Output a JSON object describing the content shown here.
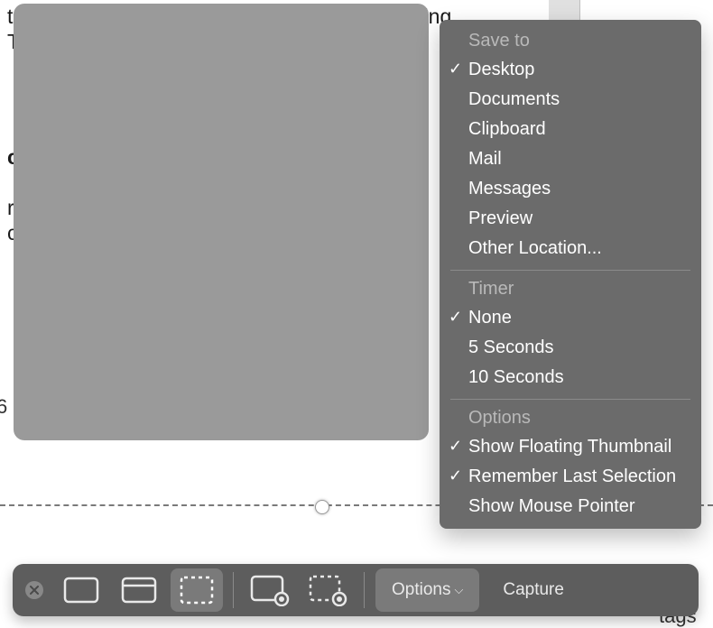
{
  "background": {
    "line1": "t means you want to screenshot without opening",
    "line2": "T",
    "bold": "c",
    "line3": "r",
    "line4": "cl",
    "num": "6",
    "tags": "tags"
  },
  "menu": {
    "save_to": {
      "title": "Save to",
      "items": [
        {
          "label": "Desktop",
          "checked": true
        },
        {
          "label": "Documents",
          "checked": false
        },
        {
          "label": "Clipboard",
          "checked": false
        },
        {
          "label": "Mail",
          "checked": false
        },
        {
          "label": "Messages",
          "checked": false
        },
        {
          "label": "Preview",
          "checked": false
        },
        {
          "label": "Other Location...",
          "checked": false
        }
      ]
    },
    "timer": {
      "title": "Timer",
      "items": [
        {
          "label": "None",
          "checked": true
        },
        {
          "label": "5 Seconds",
          "checked": false
        },
        {
          "label": "10 Seconds",
          "checked": false
        }
      ]
    },
    "options": {
      "title": "Options",
      "items": [
        {
          "label": "Show Floating Thumbnail",
          "checked": true
        },
        {
          "label": "Remember Last Selection",
          "checked": true
        },
        {
          "label": "Show Mouse Pointer",
          "checked": false
        }
      ]
    }
  },
  "toolbar": {
    "options_label": "Options",
    "capture_label": "Capture"
  }
}
